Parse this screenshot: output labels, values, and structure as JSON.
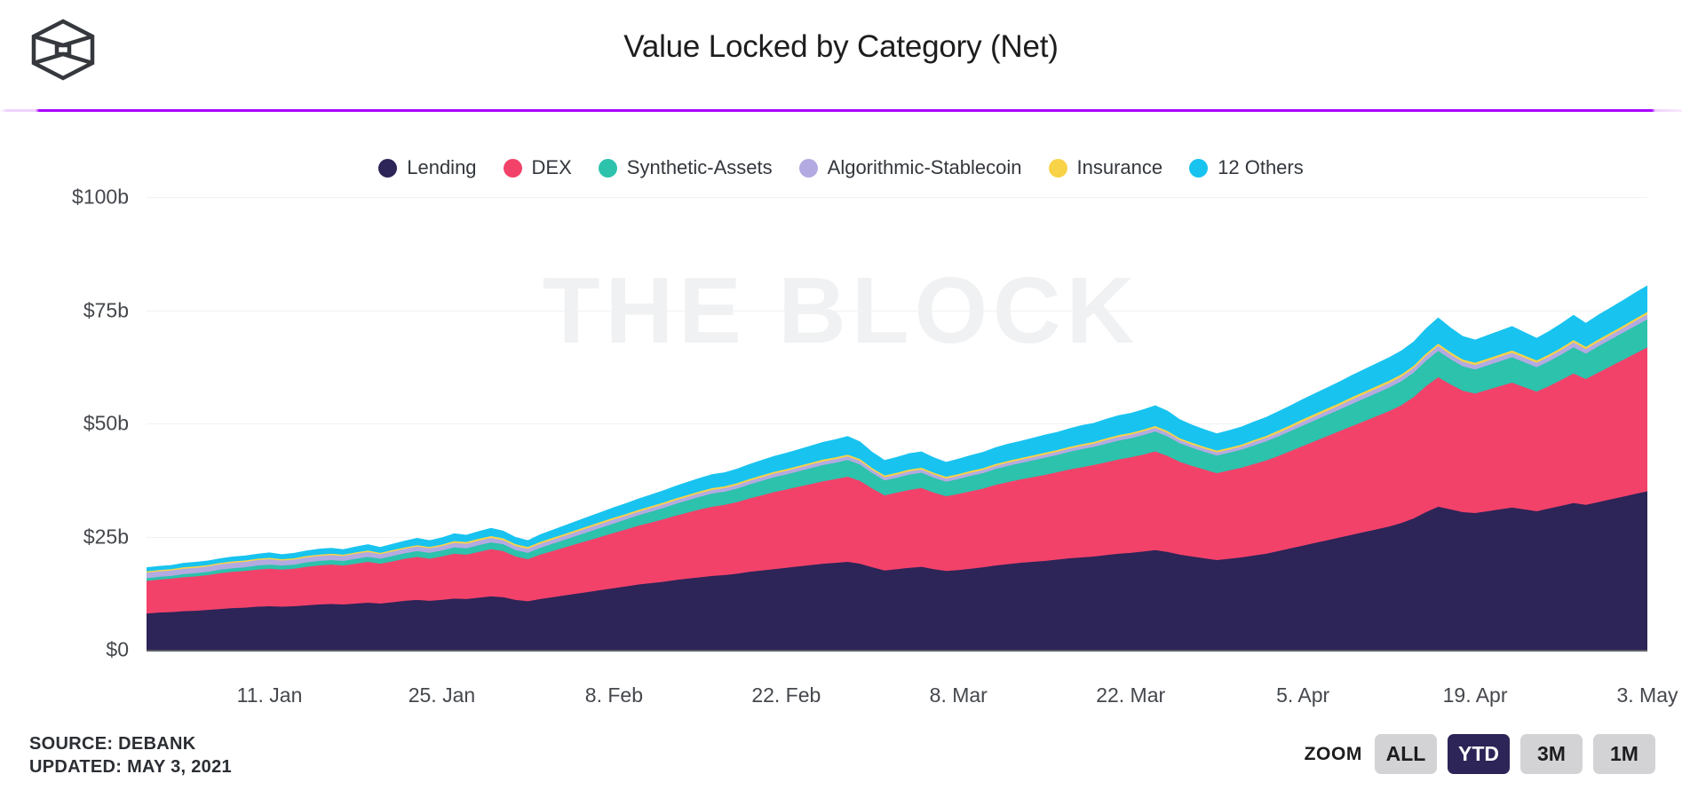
{
  "header": {
    "title": "Value Locked by Category (Net)",
    "logo_icon": "the-block-cube-logo",
    "divider_color": "#aa00ff"
  },
  "watermark": "THE BLOCK",
  "legend": {
    "items": [
      {
        "label": "Lending",
        "color": "#2d2457"
      },
      {
        "label": "DEX",
        "color": "#f2426a"
      },
      {
        "label": "Synthetic-Assets",
        "color": "#2cc2ac"
      },
      {
        "label": "Algorithmic-Stablecoin",
        "color": "#b3aae2"
      },
      {
        "label": "Insurance",
        "color": "#f8d348"
      },
      {
        "label": "12 Others",
        "color": "#18c3f0"
      }
    ]
  },
  "footer": {
    "source": "SOURCE: DEBANK",
    "updated": "UPDATED: MAY 3, 2021",
    "zoom_label": "ZOOM",
    "zoom_buttons": [
      {
        "label": "ALL",
        "active": false
      },
      {
        "label": "YTD",
        "active": true
      },
      {
        "label": "3M",
        "active": false
      },
      {
        "label": "1M",
        "active": false
      }
    ]
  },
  "chart_data": {
    "type": "area",
    "stacked": true,
    "title": "Value Locked by Category (Net)",
    "xlabel": "",
    "ylabel": "",
    "ylim": [
      0,
      100
    ],
    "y_unit": "billions USD",
    "y_ticks": [
      0,
      25,
      50,
      75,
      100
    ],
    "y_tick_labels": [
      "$0",
      "$25b",
      "$50b",
      "$75b",
      "$100b"
    ],
    "grid": true,
    "legend_position": "top-center",
    "x_tick_labels": [
      "11. Jan",
      "25. Jan",
      "8. Feb",
      "22. Feb",
      "8. Mar",
      "22. Mar",
      "5. Apr",
      "19. Apr",
      "3. May"
    ],
    "x_tick_indices": [
      10,
      24,
      38,
      52,
      66,
      80,
      94,
      108,
      122
    ],
    "x_start": "2021-01-01",
    "x_end": "2021-05-03",
    "n_points": 123,
    "series": [
      {
        "name": "Lending",
        "color": "#2d2457",
        "values": [
          8.0,
          8.2,
          8.3,
          8.5,
          8.6,
          8.8,
          9.0,
          9.2,
          9.3,
          9.5,
          9.6,
          9.5,
          9.6,
          9.8,
          10.0,
          10.1,
          10.0,
          10.2,
          10.4,
          10.2,
          10.5,
          10.8,
          11.0,
          10.8,
          11.0,
          11.3,
          11.2,
          11.5,
          11.8,
          11.6,
          11.0,
          10.7,
          11.2,
          11.6,
          12.0,
          12.4,
          12.8,
          13.2,
          13.6,
          14.0,
          14.4,
          14.7,
          15.0,
          15.4,
          15.7,
          16.0,
          16.3,
          16.5,
          16.8,
          17.2,
          17.5,
          17.8,
          18.1,
          18.4,
          18.7,
          19.0,
          19.2,
          19.4,
          19.0,
          18.2,
          17.5,
          17.8,
          18.1,
          18.3,
          17.8,
          17.4,
          17.6,
          17.9,
          18.2,
          18.6,
          18.9,
          19.2,
          19.4,
          19.6,
          19.9,
          20.2,
          20.4,
          20.6,
          20.9,
          21.2,
          21.4,
          21.7,
          22.0,
          21.6,
          21.0,
          20.6,
          20.2,
          19.8,
          20.1,
          20.4,
          20.8,
          21.2,
          21.8,
          22.4,
          23.0,
          23.6,
          24.2,
          24.8,
          25.4,
          26.0,
          26.6,
          27.2,
          28.0,
          29.0,
          30.4,
          31.6,
          31.0,
          30.4,
          30.2,
          30.6,
          31.0,
          31.4,
          31.0,
          30.6,
          31.2,
          31.8,
          32.4,
          32.0,
          32.6,
          33.2,
          33.8,
          34.4,
          35.0,
          35.6,
          36.2,
          36.8,
          37.4
        ],
        "unit": "billions USD"
      },
      {
        "name": "DEX",
        "color": "#f2426a",
        "values": [
          7.2,
          7.3,
          7.4,
          7.5,
          7.6,
          7.7,
          7.9,
          8.0,
          8.1,
          8.2,
          8.3,
          8.2,
          8.3,
          8.5,
          8.6,
          8.7,
          8.6,
          8.8,
          9.0,
          8.8,
          9.0,
          9.3,
          9.5,
          9.3,
          9.6,
          9.9,
          9.8,
          10.1,
          10.4,
          10.2,
          9.6,
          9.3,
          9.8,
          10.2,
          10.6,
          11.0,
          11.4,
          11.8,
          12.2,
          12.6,
          13.0,
          13.4,
          13.8,
          14.2,
          14.6,
          15.0,
          15.3,
          15.5,
          15.8,
          16.2,
          16.6,
          17.0,
          17.3,
          17.6,
          17.9,
          18.2,
          18.5,
          18.8,
          18.3,
          17.4,
          16.6,
          16.9,
          17.2,
          17.4,
          16.9,
          16.5,
          16.8,
          17.1,
          17.4,
          17.8,
          18.1,
          18.4,
          18.7,
          19.0,
          19.3,
          19.6,
          19.9,
          20.2,
          20.5,
          20.8,
          21.1,
          21.4,
          21.8,
          21.2,
          20.5,
          20.0,
          19.6,
          19.2,
          19.5,
          19.8,
          20.2,
          20.6,
          21.0,
          21.5,
          22.0,
          22.5,
          23.0,
          23.5,
          24.0,
          24.5,
          25.0,
          25.5,
          26.0,
          26.8,
          27.8,
          28.6,
          27.6,
          26.8,
          26.4,
          26.8,
          27.2,
          27.6,
          27.0,
          26.4,
          27.0,
          27.8,
          28.6,
          27.8,
          28.6,
          29.4,
          30.2,
          31.0,
          31.8,
          32.6,
          33.4,
          34.2,
          35.0
        ],
        "unit": "billions USD"
      },
      {
        "name": "Synthetic-Assets",
        "color": "#2cc2ac",
        "values": [
          0.6,
          0.6,
          0.6,
          0.7,
          0.7,
          0.7,
          0.8,
          0.8,
          0.8,
          0.9,
          0.9,
          0.9,
          0.9,
          1.0,
          1.0,
          1.0,
          1.0,
          1.1,
          1.1,
          1.1,
          1.2,
          1.2,
          1.3,
          1.3,
          1.3,
          1.4,
          1.4,
          1.5,
          1.5,
          1.5,
          1.4,
          1.4,
          1.5,
          1.6,
          1.7,
          1.8,
          1.9,
          2.0,
          2.1,
          2.2,
          2.3,
          2.4,
          2.5,
          2.6,
          2.7,
          2.8,
          2.9,
          2.9,
          3.0,
          3.1,
          3.2,
          3.3,
          3.3,
          3.4,
          3.5,
          3.6,
          3.6,
          3.7,
          3.6,
          3.4,
          3.3,
          3.3,
          3.4,
          3.4,
          3.3,
          3.2,
          3.3,
          3.4,
          3.4,
          3.5,
          3.6,
          3.6,
          3.7,
          3.8,
          3.8,
          3.9,
          4.0,
          4.0,
          4.1,
          4.2,
          4.2,
          4.3,
          4.4,
          4.3,
          4.1,
          4.0,
          3.9,
          3.9,
          3.9,
          4.0,
          4.1,
          4.2,
          4.3,
          4.4,
          4.5,
          4.6,
          4.7,
          4.8,
          4.9,
          5.0,
          5.1,
          5.2,
          5.3,
          5.4,
          5.6,
          5.8,
          5.6,
          5.4,
          5.3,
          5.4,
          5.5,
          5.6,
          5.5,
          5.4,
          5.5,
          5.6,
          5.8,
          5.6,
          5.8,
          5.9,
          6.0,
          6.1,
          6.2,
          6.3,
          6.4,
          6.5,
          6.6
        ],
        "unit": "billions USD"
      },
      {
        "name": "Algorithmic-Stablecoin",
        "color": "#b3aae2",
        "values": [
          1.2,
          1.2,
          1.2,
          1.2,
          1.2,
          1.2,
          1.2,
          1.2,
          1.2,
          1.2,
          1.2,
          1.1,
          1.1,
          1.1,
          1.1,
          1.1,
          1.1,
          1.1,
          1.1,
          1.0,
          1.0,
          1.0,
          1.0,
          1.0,
          1.0,
          1.0,
          1.0,
          1.0,
          1.0,
          0.9,
          0.9,
          0.9,
          0.9,
          0.9,
          0.9,
          0.9,
          0.9,
          0.9,
          0.9,
          0.8,
          0.8,
          0.8,
          0.8,
          0.8,
          0.8,
          0.8,
          0.8,
          0.8,
          0.8,
          0.8,
          0.8,
          0.8,
          0.8,
          0.8,
          0.8,
          0.8,
          0.8,
          0.8,
          0.8,
          0.7,
          0.7,
          0.7,
          0.7,
          0.7,
          0.7,
          0.7,
          0.7,
          0.7,
          0.7,
          0.7,
          0.7,
          0.7,
          0.7,
          0.7,
          0.7,
          0.7,
          0.7,
          0.7,
          0.8,
          0.8,
          0.8,
          0.8,
          0.8,
          0.8,
          0.7,
          0.7,
          0.7,
          0.7,
          0.7,
          0.7,
          0.8,
          0.8,
          0.8,
          0.8,
          0.9,
          0.9,
          0.9,
          0.9,
          1.0,
          1.0,
          1.0,
          1.0,
          1.0,
          1.0,
          1.1,
          1.1,
          1.0,
          1.0,
          1.0,
          1.0,
          1.0,
          1.0,
          1.0,
          1.0,
          1.0,
          1.0,
          1.1,
          1.0,
          1.0,
          1.0,
          1.0,
          1.1,
          1.1,
          1.1,
          1.1,
          1.1,
          1.1
        ],
        "unit": "billions USD"
      },
      {
        "name": "Insurance",
        "color": "#f8d348",
        "values": [
          0.3,
          0.3,
          0.3,
          0.3,
          0.3,
          0.3,
          0.3,
          0.3,
          0.3,
          0.3,
          0.3,
          0.3,
          0.3,
          0.3,
          0.3,
          0.3,
          0.3,
          0.3,
          0.3,
          0.3,
          0.3,
          0.3,
          0.3,
          0.3,
          0.3,
          0.4,
          0.4,
          0.4,
          0.4,
          0.4,
          0.4,
          0.4,
          0.4,
          0.4,
          0.4,
          0.4,
          0.4,
          0.4,
          0.4,
          0.4,
          0.4,
          0.4,
          0.4,
          0.4,
          0.4,
          0.4,
          0.4,
          0.4,
          0.4,
          0.4,
          0.4,
          0.4,
          0.4,
          0.4,
          0.4,
          0.4,
          0.4,
          0.4,
          0.4,
          0.4,
          0.4,
          0.4,
          0.4,
          0.4,
          0.4,
          0.4,
          0.4,
          0.4,
          0.4,
          0.4,
          0.4,
          0.4,
          0.4,
          0.4,
          0.4,
          0.4,
          0.4,
          0.4,
          0.4,
          0.4,
          0.4,
          0.4,
          0.4,
          0.4,
          0.4,
          0.4,
          0.4,
          0.4,
          0.4,
          0.4,
          0.4,
          0.4,
          0.5,
          0.5,
          0.5,
          0.5,
          0.5,
          0.5,
          0.5,
          0.5,
          0.5,
          0.5,
          0.5,
          0.5,
          0.5,
          0.5,
          0.5,
          0.5,
          0.5,
          0.5,
          0.5,
          0.5,
          0.5,
          0.5,
          0.5,
          0.5,
          0.5,
          0.5,
          0.5,
          0.5,
          0.5,
          0.5,
          0.5,
          0.5,
          0.5,
          0.5
        ],
        "unit": "billions USD"
      },
      {
        "name": "12 Others",
        "color": "#18c3f0",
        "values": [
          0.9,
          0.9,
          0.9,
          1.0,
          1.0,
          1.0,
          1.0,
          1.1,
          1.1,
          1.1,
          1.2,
          1.1,
          1.2,
          1.2,
          1.3,
          1.3,
          1.2,
          1.3,
          1.4,
          1.3,
          1.4,
          1.5,
          1.6,
          1.5,
          1.6,
          1.7,
          1.6,
          1.7,
          1.8,
          1.7,
          1.6,
          1.5,
          1.7,
          1.8,
          1.9,
          2.0,
          2.1,
          2.2,
          2.3,
          2.4,
          2.5,
          2.6,
          2.7,
          2.8,
          2.9,
          3.0,
          3.1,
          3.1,
          3.2,
          3.3,
          3.4,
          3.5,
          3.6,
          3.7,
          3.8,
          3.9,
          4.0,
          4.1,
          3.9,
          3.6,
          3.4,
          3.5,
          3.6,
          3.6,
          3.4,
          3.3,
          3.4,
          3.5,
          3.6,
          3.7,
          3.8,
          3.8,
          3.9,
          4.0,
          4.0,
          4.1,
          4.2,
          4.2,
          4.3,
          4.4,
          4.4,
          4.5,
          4.6,
          4.5,
          4.2,
          4.0,
          3.9,
          3.8,
          3.9,
          4.0,
          4.1,
          4.2,
          4.3,
          4.4,
          4.5,
          4.6,
          4.7,
          4.8,
          4.9,
          5.0,
          5.1,
          5.2,
          5.3,
          5.4,
          5.6,
          5.8,
          5.5,
          5.2,
          5.1,
          5.2,
          5.3,
          5.4,
          5.2,
          5.0,
          5.2,
          5.4,
          5.6,
          5.3,
          5.5,
          5.6,
          5.7,
          5.8,
          5.9,
          6.0,
          6.1,
          6.2,
          6.3
        ],
        "unit": "billions USD"
      }
    ]
  }
}
